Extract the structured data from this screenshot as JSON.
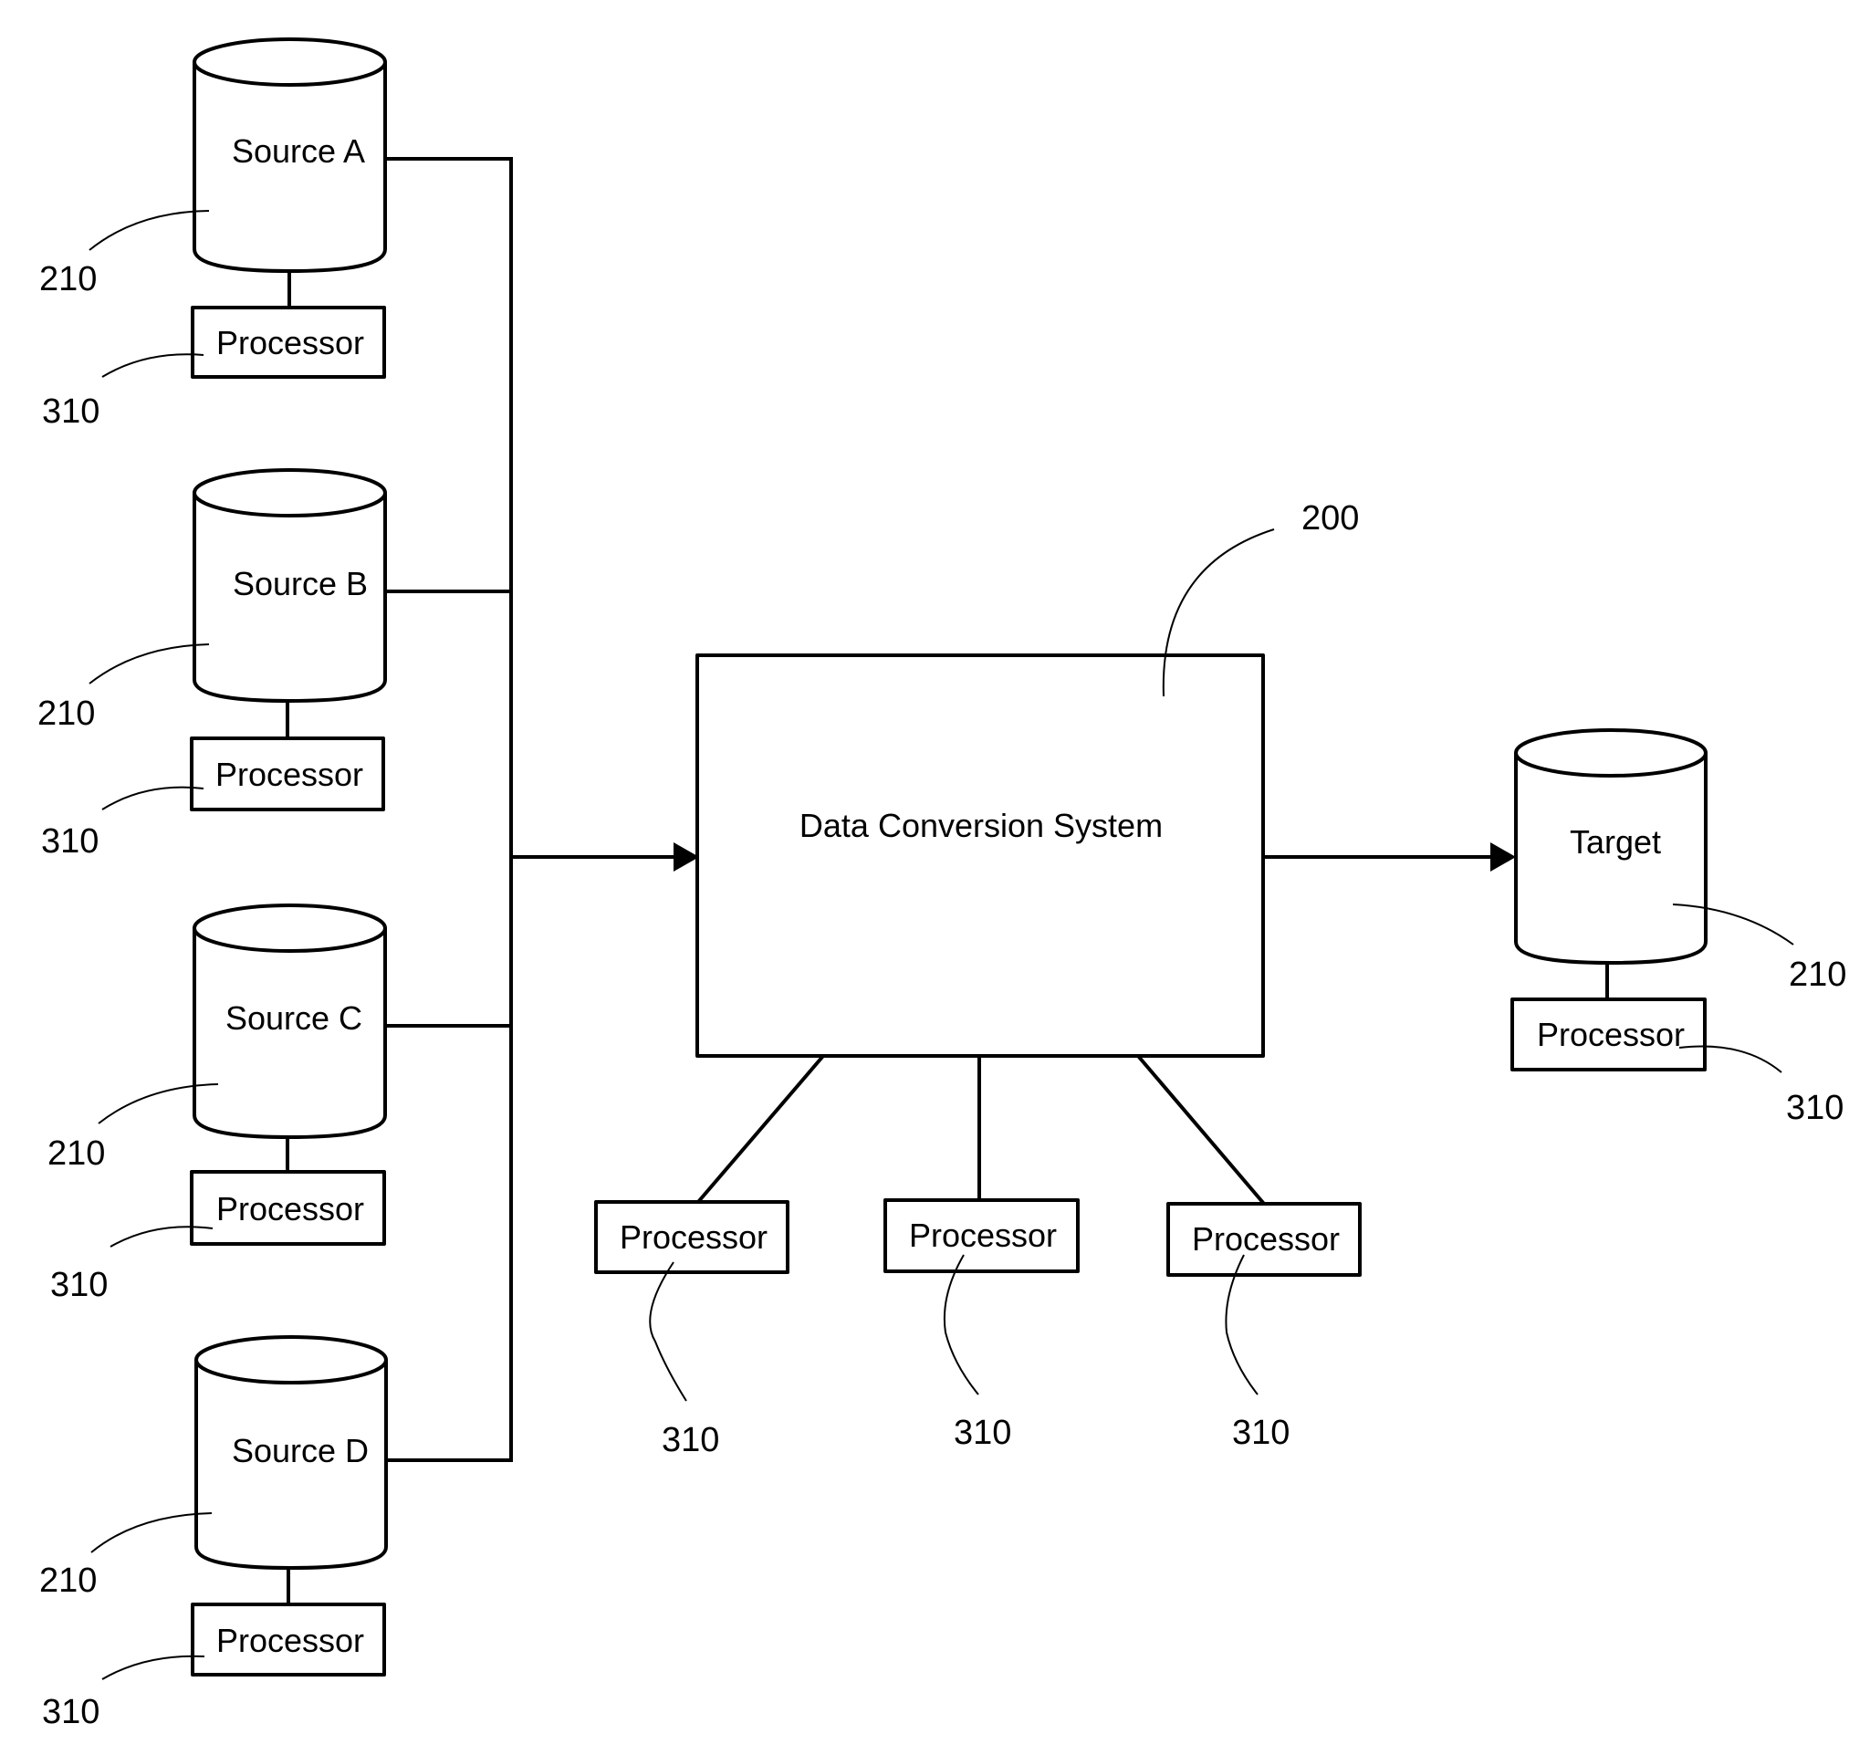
{
  "diagram": {
    "central_system": {
      "label": "Data Conversion System",
      "ref": "200"
    },
    "sources": [
      {
        "label": "Source A",
        "ref": "210",
        "processor": {
          "label": "Processor",
          "ref": "310"
        }
      },
      {
        "label": "Source B",
        "ref": "210",
        "processor": {
          "label": "Processor",
          "ref": "310"
        }
      },
      {
        "label": "Source C",
        "ref": "210",
        "processor": {
          "label": "Processor",
          "ref": "310"
        }
      },
      {
        "label": "Source D",
        "ref": "210",
        "processor": {
          "label": "Processor",
          "ref": "310"
        }
      }
    ],
    "target": {
      "label": "Target",
      "ref": "210",
      "processor": {
        "label": "Processor",
        "ref": "310"
      }
    },
    "system_processors": [
      {
        "label": "Processor",
        "ref": "310"
      },
      {
        "label": "Processor",
        "ref": "310"
      },
      {
        "label": "Processor",
        "ref": "310"
      }
    ],
    "edges": [
      {
        "from": "Source A",
        "to": "Data Conversion System",
        "via": "bus"
      },
      {
        "from": "Source B",
        "to": "Data Conversion System",
        "via": "bus"
      },
      {
        "from": "Source C",
        "to": "Data Conversion System",
        "via": "bus"
      },
      {
        "from": "Source D",
        "to": "Data Conversion System",
        "via": "bus"
      },
      {
        "from": "Data Conversion System",
        "to": "Target",
        "arrow": true
      }
    ]
  }
}
